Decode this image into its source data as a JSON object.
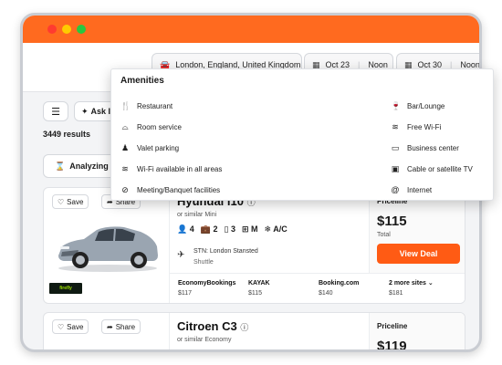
{
  "search": {
    "location": "London, England, United Kingdom",
    "pickup_date": "Oct 23",
    "pickup_time": "Noon",
    "dropoff_date": "Oct 30",
    "dropoff_time": "Noon"
  },
  "toolbar": {
    "ask_label": "Ask I",
    "results_count": "3449 results",
    "analyzing_label": "Analyzing p"
  },
  "amenities": {
    "title": "Amenities",
    "left": [
      "Restaurant",
      "Room service",
      "Valet parking",
      "Wi-Fi available in all areas",
      "Meeting/Banquet facilities"
    ],
    "right": [
      "Bar/Lounge",
      "Free Wi-Fi",
      "Business center",
      "Cable or satellite TV",
      "Internet"
    ]
  },
  "card1": {
    "save_label": "Save",
    "share_label": "Share",
    "car_name": "Hyundai i10",
    "car_sub": "or similar Mini",
    "specs": {
      "seats": "4",
      "bags": "2",
      "doors": "3",
      "trans": "M",
      "ac": "A/C"
    },
    "pickup_location": "STN: London Stansted",
    "pickup_type": "Shuttle",
    "supplier": "firefly",
    "provider": "Priceline",
    "price": "$115",
    "price_label": "Total",
    "deal_label": "View Deal",
    "compare": [
      {
        "name": "EconomyBookings",
        "value": "$117"
      },
      {
        "name": "KAYAK",
        "value": "$115"
      },
      {
        "name": "Booking.com",
        "value": "$140"
      },
      {
        "name": "2 more sites",
        "value": "$181"
      }
    ]
  },
  "card2": {
    "save_label": "Save",
    "share_label": "Share",
    "car_name": "Citroen C3",
    "car_sub": "or similar Economy",
    "provider": "Priceline",
    "price": "$119"
  },
  "colors": {
    "brand_orange": "#ff6a1f",
    "deal_button": "#ff5b14"
  },
  "icons": [
    "car-icon",
    "calendar-icon",
    "sliders-icon",
    "sparkle-icon",
    "heart-icon",
    "share-icon",
    "info-icon",
    "person-icon",
    "suitcase-icon",
    "door-icon",
    "gearbox-icon",
    "snowflake-icon",
    "plane-icon",
    "chevron-down-icon",
    "fork-knife-icon",
    "room-service-icon",
    "valet-icon",
    "wifi-icon",
    "meeting-icon",
    "bar-icon",
    "business-icon",
    "tv-icon",
    "at-icon"
  ]
}
